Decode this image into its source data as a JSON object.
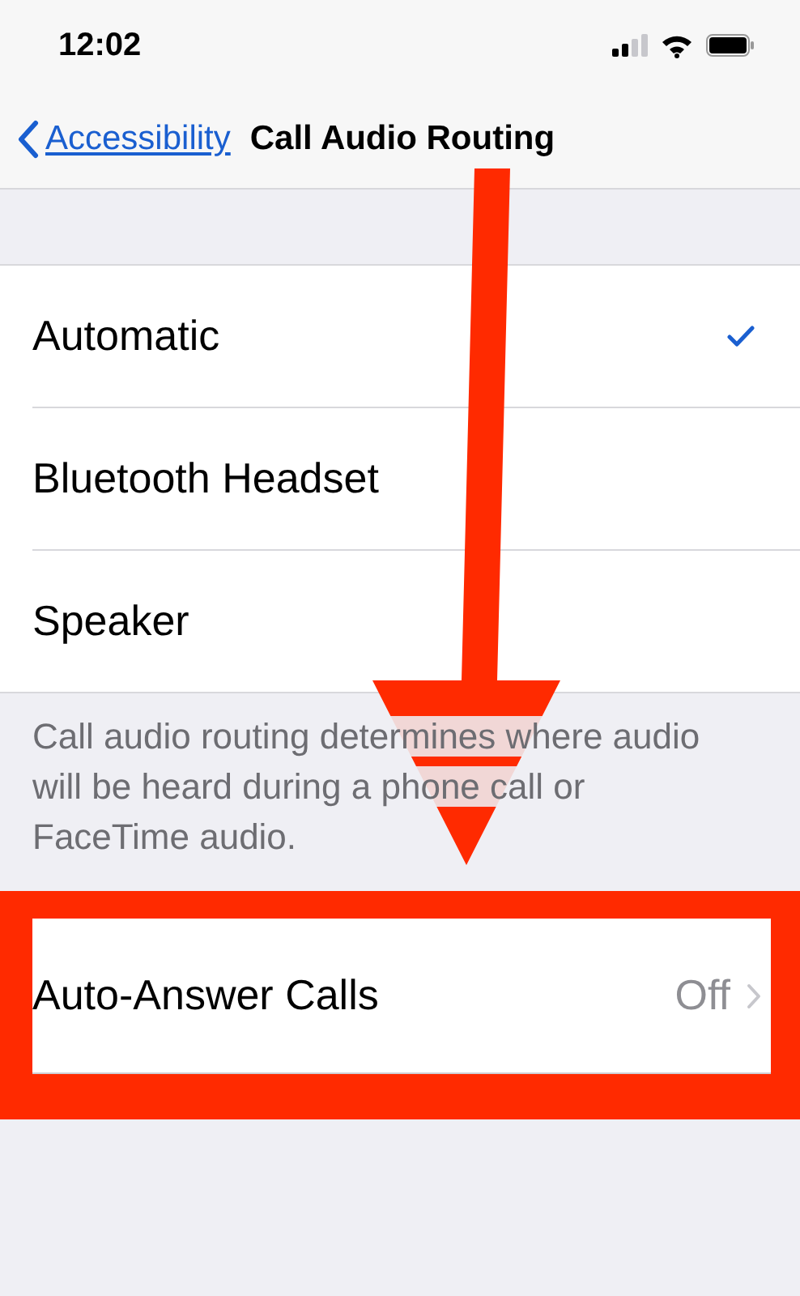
{
  "status_bar": {
    "time": "12:02"
  },
  "nav": {
    "back": "Accessibility",
    "title": "Call Audio Routing"
  },
  "options": [
    {
      "label": "Automatic",
      "selected": true
    },
    {
      "label": "Bluetooth Headset",
      "selected": false
    },
    {
      "label": "Speaker",
      "selected": false
    }
  ],
  "footer": "Call audio routing determines where audio will be heard during a phone call or FaceTime audio.",
  "auto_answer": {
    "label": "Auto-Answer Calls",
    "value": "Off",
    "highlighted": true
  },
  "annotation": {
    "arrow": true
  }
}
